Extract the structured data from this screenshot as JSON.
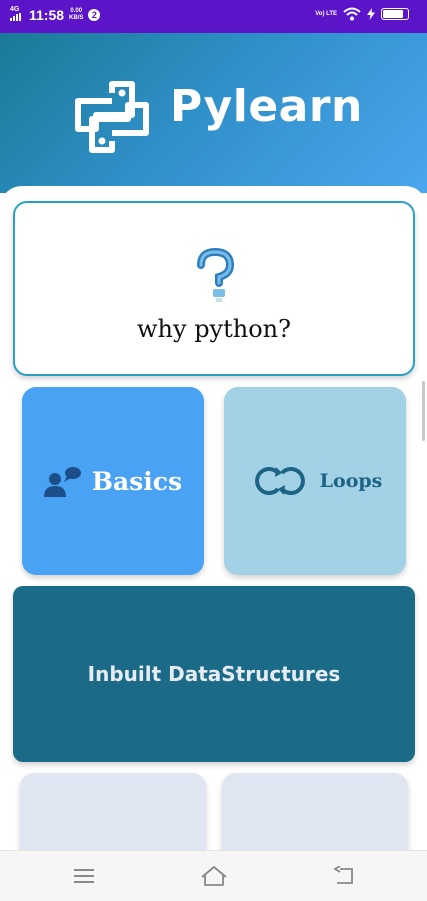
{
  "status_bar": {
    "time": "11:58",
    "network": "4G",
    "data_speed_value": "0.00",
    "data_speed_unit": "KB/S",
    "notification_count": "2",
    "volte": "Vo) LTE",
    "battery_level": 0.85
  },
  "header": {
    "app_title": "Pylearn"
  },
  "cards": {
    "why_python": "why python?",
    "basics": "Basics",
    "loops": "Loops",
    "inbuilt": "Inbuilt DataStructures"
  },
  "icons": {
    "logo": "python-logo-icon",
    "why": "question-mark-icon",
    "basics": "people-chat-icon",
    "loops": "loop-arrows-icon",
    "nav_menu": "menu-icon",
    "nav_home": "home-icon",
    "nav_back": "back-icon"
  },
  "colors": {
    "status_bar": "#5b14c8",
    "header_start": "#1a7a96",
    "header_end": "#4aa6ee",
    "why_border": "#2e9fc4",
    "basics": "#4aa2f5",
    "loops": "#a3d1e6",
    "inbuilt": "#1a6a88",
    "more": "#dfe5f1"
  }
}
